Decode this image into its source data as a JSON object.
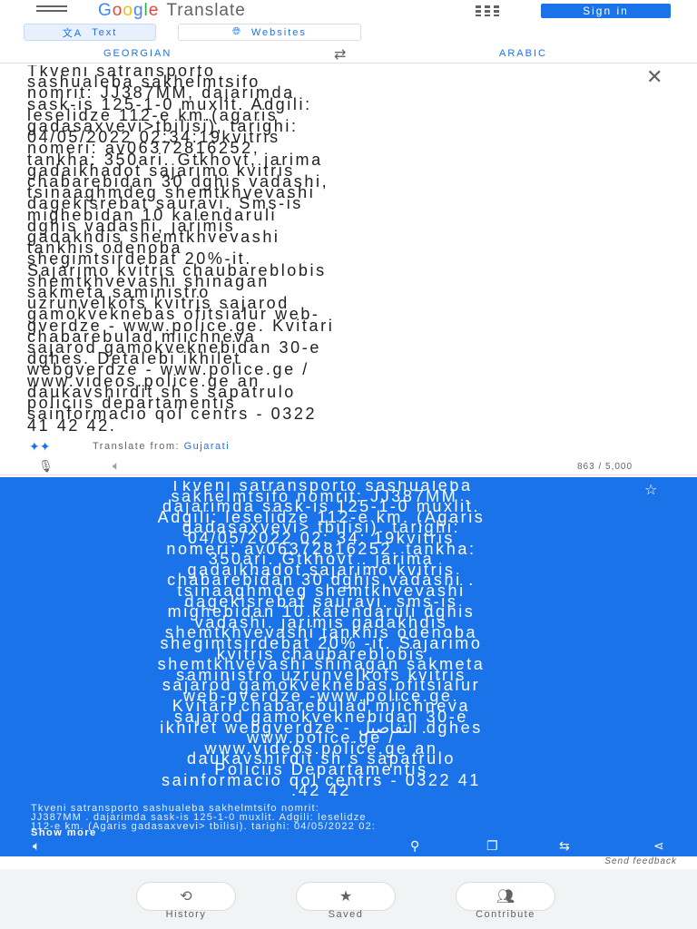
{
  "header": {
    "brand_letters": [
      "G",
      "o",
      "o",
      "g",
      "l",
      "e"
    ],
    "brand_word": "Translate",
    "sign_in": "Sign in"
  },
  "modes": {
    "text": "Text",
    "websites": "Websites"
  },
  "languages": {
    "source": "GEORGIAN",
    "target": "ARABIC"
  },
  "source": {
    "text": "Tkveni satransporto\nsashualeba sakhelmtsifo\nnomrit: JJ387MM, dajarimda\nsask-is 125-1-0 muxlit. Adgili:\nleselidze 112-e km.(agaris\ngadasaxvevi>tbilisi), tarighi:\n04/05/2022 02:34:19kvitris\nnomeri: av06372816252,\ntankha: 350ari. Gtkhovt, jarima\ngadaikhadot sajarimo kvitris\nchabarebidan 30 dghis vadashi,\ntsinaaghmdeg shemtkhvevashi\ndagekisrebat sauravi. Sms-is\nmighebidan 10 kalendaruli\ndghis vadashi, jarimis\ngadakhdis shemtkhvevashi\ntankhis odenoba\nshegimtsirdebat 20%-it.\nSajarimo kvitris chaubareblobis\nshemtkhvevashi shinagan\nsakmeta saministro\nuzrunvelkofs kvitris sajarod\ngamokveknebas ofitsialur web-\ngverdze - www.police.ge. Kvitari\nchabarebulad miichneva\nsajarod gamokveknebidan 30-e\ndghes. Detalebi ikhilet\nwebgverdze - www.police.ge /\nwww.videos.police.ge an\ndaukavshirdit sh s sapatrulo\npoliciis departamentis\nsainformacio qol centrs - 0322\n41 42 42.",
    "translate_from_label": "Translate from: ",
    "translate_from_lang": "Gujarati",
    "char_count": "863 / 5,000"
  },
  "result": {
    "text": "Tkveni satransporto sashualeba\nsakhelmtsifo nomrit: JJ387MM .\ndajarimda sask-is 125-1-0 muxlit.\nAdgili: leselidze 112-e km. (Agaris\ngadasaxvevi> tbilisi). tarighi:\n04/05/2022 02: 34: 19kvitris\nnomeri: av06372816252. tankha:\n350ari. Gtkhovt . jarima\ngadaikhadot sajarimo kvitris\nchabarebidan 30 dghis vadashi .\ntsinaaghmdeg shemtkhvevashi\ndagekisrebat sauravi. sms-is\nmighebidan 10 kalendaruli dghis\nvadashi. jarimis gadakhdis\nshemtkhvevashi tankhis odenoba\nshegimtsirdebat 20% -it. Sajarimo\nkvitris chaubareblobis\nshemtkhvevashi shinagan sakmeta\nsaministro uzrunvelkofs kvitris\nsajarod gamokveknebas ofitsialur\nweb-gverdze -www.police.ge.\nKvitari chabarebulad miichneva\nsajarod gamokveknebidan 30-e\nikhilet webgverdze - التفاصيل .dghes\nwww.police.ge /\nwww.videos.police.ge an\ndaukavshirdit sh s sapatrulo\nPoliciis Departamentis\nsainformacio qol centrs - 0322 41\n.42 42",
    "romanized": "Tkveni satransporto sashualeba sakhelmtsifo nomrit:\nJJ387MM . dajarimda sask-is 125-1-0 muxlit. Adgili: leselidze\n112-e km. (Agaris gadasaxvevi> tbilisi). tarighi: 04/05/2022 02:",
    "show_more": "Show more",
    "send_feedback": "Send feedback"
  },
  "bottom_nav": {
    "history": "History",
    "saved": "Saved",
    "contribute": "Contribute"
  },
  "colors": {
    "accent": "#1a73e8",
    "panel": "#1a73e8",
    "nav_bg": "#f1f3f4"
  }
}
